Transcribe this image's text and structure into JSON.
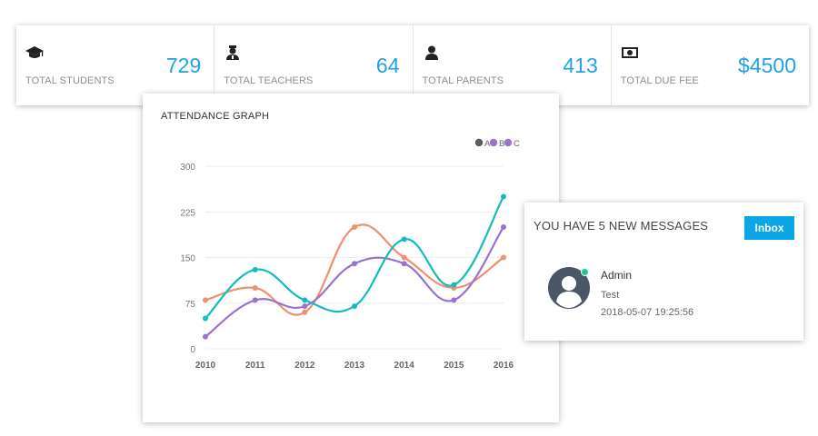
{
  "stats": [
    {
      "label": "TOTAL STUDENTS",
      "value": "729",
      "icon": "graduation-cap-icon"
    },
    {
      "label": "TOTAL TEACHERS",
      "value": "64",
      "icon": "teacher-icon"
    },
    {
      "label": "TOTAL PARENTS",
      "value": "413",
      "icon": "user-icon"
    },
    {
      "label": "TOTAL DUE FEE",
      "value": "$4500",
      "icon": "money-icon"
    }
  ],
  "attendance": {
    "title": "ATTENDANCE GRAPH"
  },
  "chart_data": {
    "type": "line",
    "x": [
      "2010",
      "2011",
      "2012",
      "2013",
      "2014",
      "2015",
      "2016"
    ],
    "series": [
      {
        "name": "A",
        "color": "#f0906c",
        "values": [
          80,
          100,
          60,
          200,
          150,
          100,
          150
        ]
      },
      {
        "name": "B",
        "color": "#9b72cf",
        "values": [
          20,
          80,
          70,
          140,
          140,
          80,
          200
        ]
      },
      {
        "name": "C",
        "color": "#14bdbd",
        "values": [
          50,
          130,
          80,
          70,
          180,
          105,
          250
        ]
      }
    ],
    "legend": [
      {
        "name": "A",
        "color": "#5b5b5b"
      },
      {
        "name": "B",
        "color": "#9b72cf"
      },
      {
        "name": "C",
        "color": "#9b72cf"
      }
    ],
    "yticks": [
      "0",
      "75",
      "150",
      "225",
      "300"
    ],
    "ylim": [
      0,
      300
    ],
    "grid": true,
    "legend_position": "top-right"
  },
  "messages": {
    "title": "YOU HAVE 5 NEW MESSAGES",
    "inbox_label": "Inbox",
    "items": [
      {
        "name": "Admin",
        "text": "Test",
        "time": "2018-05-07 19:25:56"
      }
    ]
  }
}
